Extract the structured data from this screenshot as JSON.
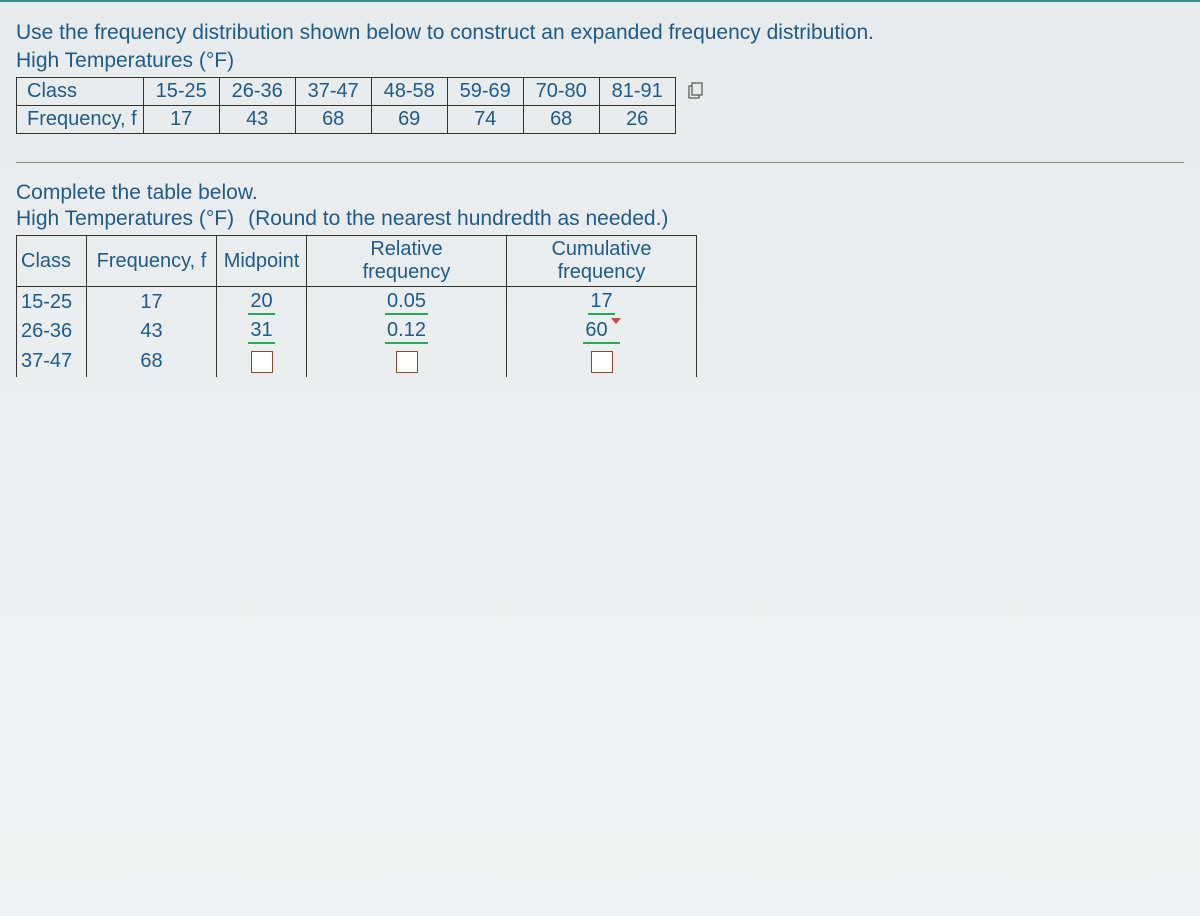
{
  "instruction": "Use the frequency distribution shown below to construct an expanded frequency distribution.",
  "subtitle": "High Temperatures (°F)",
  "topTable": {
    "rowLabels": [
      "Class",
      "Frequency, f"
    ],
    "columns": [
      "15-25",
      "26-36",
      "37-47",
      "48-58",
      "59-69",
      "70-80",
      "81-91"
    ],
    "values": [
      "17",
      "43",
      "68",
      "69",
      "74",
      "68",
      "26"
    ]
  },
  "section2": {
    "line1": "Complete the table below.",
    "line2a": "High Temperatures (°F)",
    "line2b": "(Round to the nearest hundredth as needed.)"
  },
  "bottomTable": {
    "headers": {
      "class": "Class",
      "freq": "Frequency, f",
      "mid": "Midpoint",
      "rel1": "Relative",
      "rel2": "frequency",
      "cum1": "Cumulative",
      "cum2": "frequency"
    },
    "rows": [
      {
        "class": "15-25",
        "freq": "17",
        "mid": "20",
        "rel": "0.05",
        "cum": "17",
        "marker": false
      },
      {
        "class": "26-36",
        "freq": "43",
        "mid": "31",
        "rel": "0.12",
        "cum": "60",
        "marker": true
      },
      {
        "class": "37-47",
        "freq": "68",
        "mid": "",
        "rel": "",
        "cum": ""
      }
    ]
  }
}
